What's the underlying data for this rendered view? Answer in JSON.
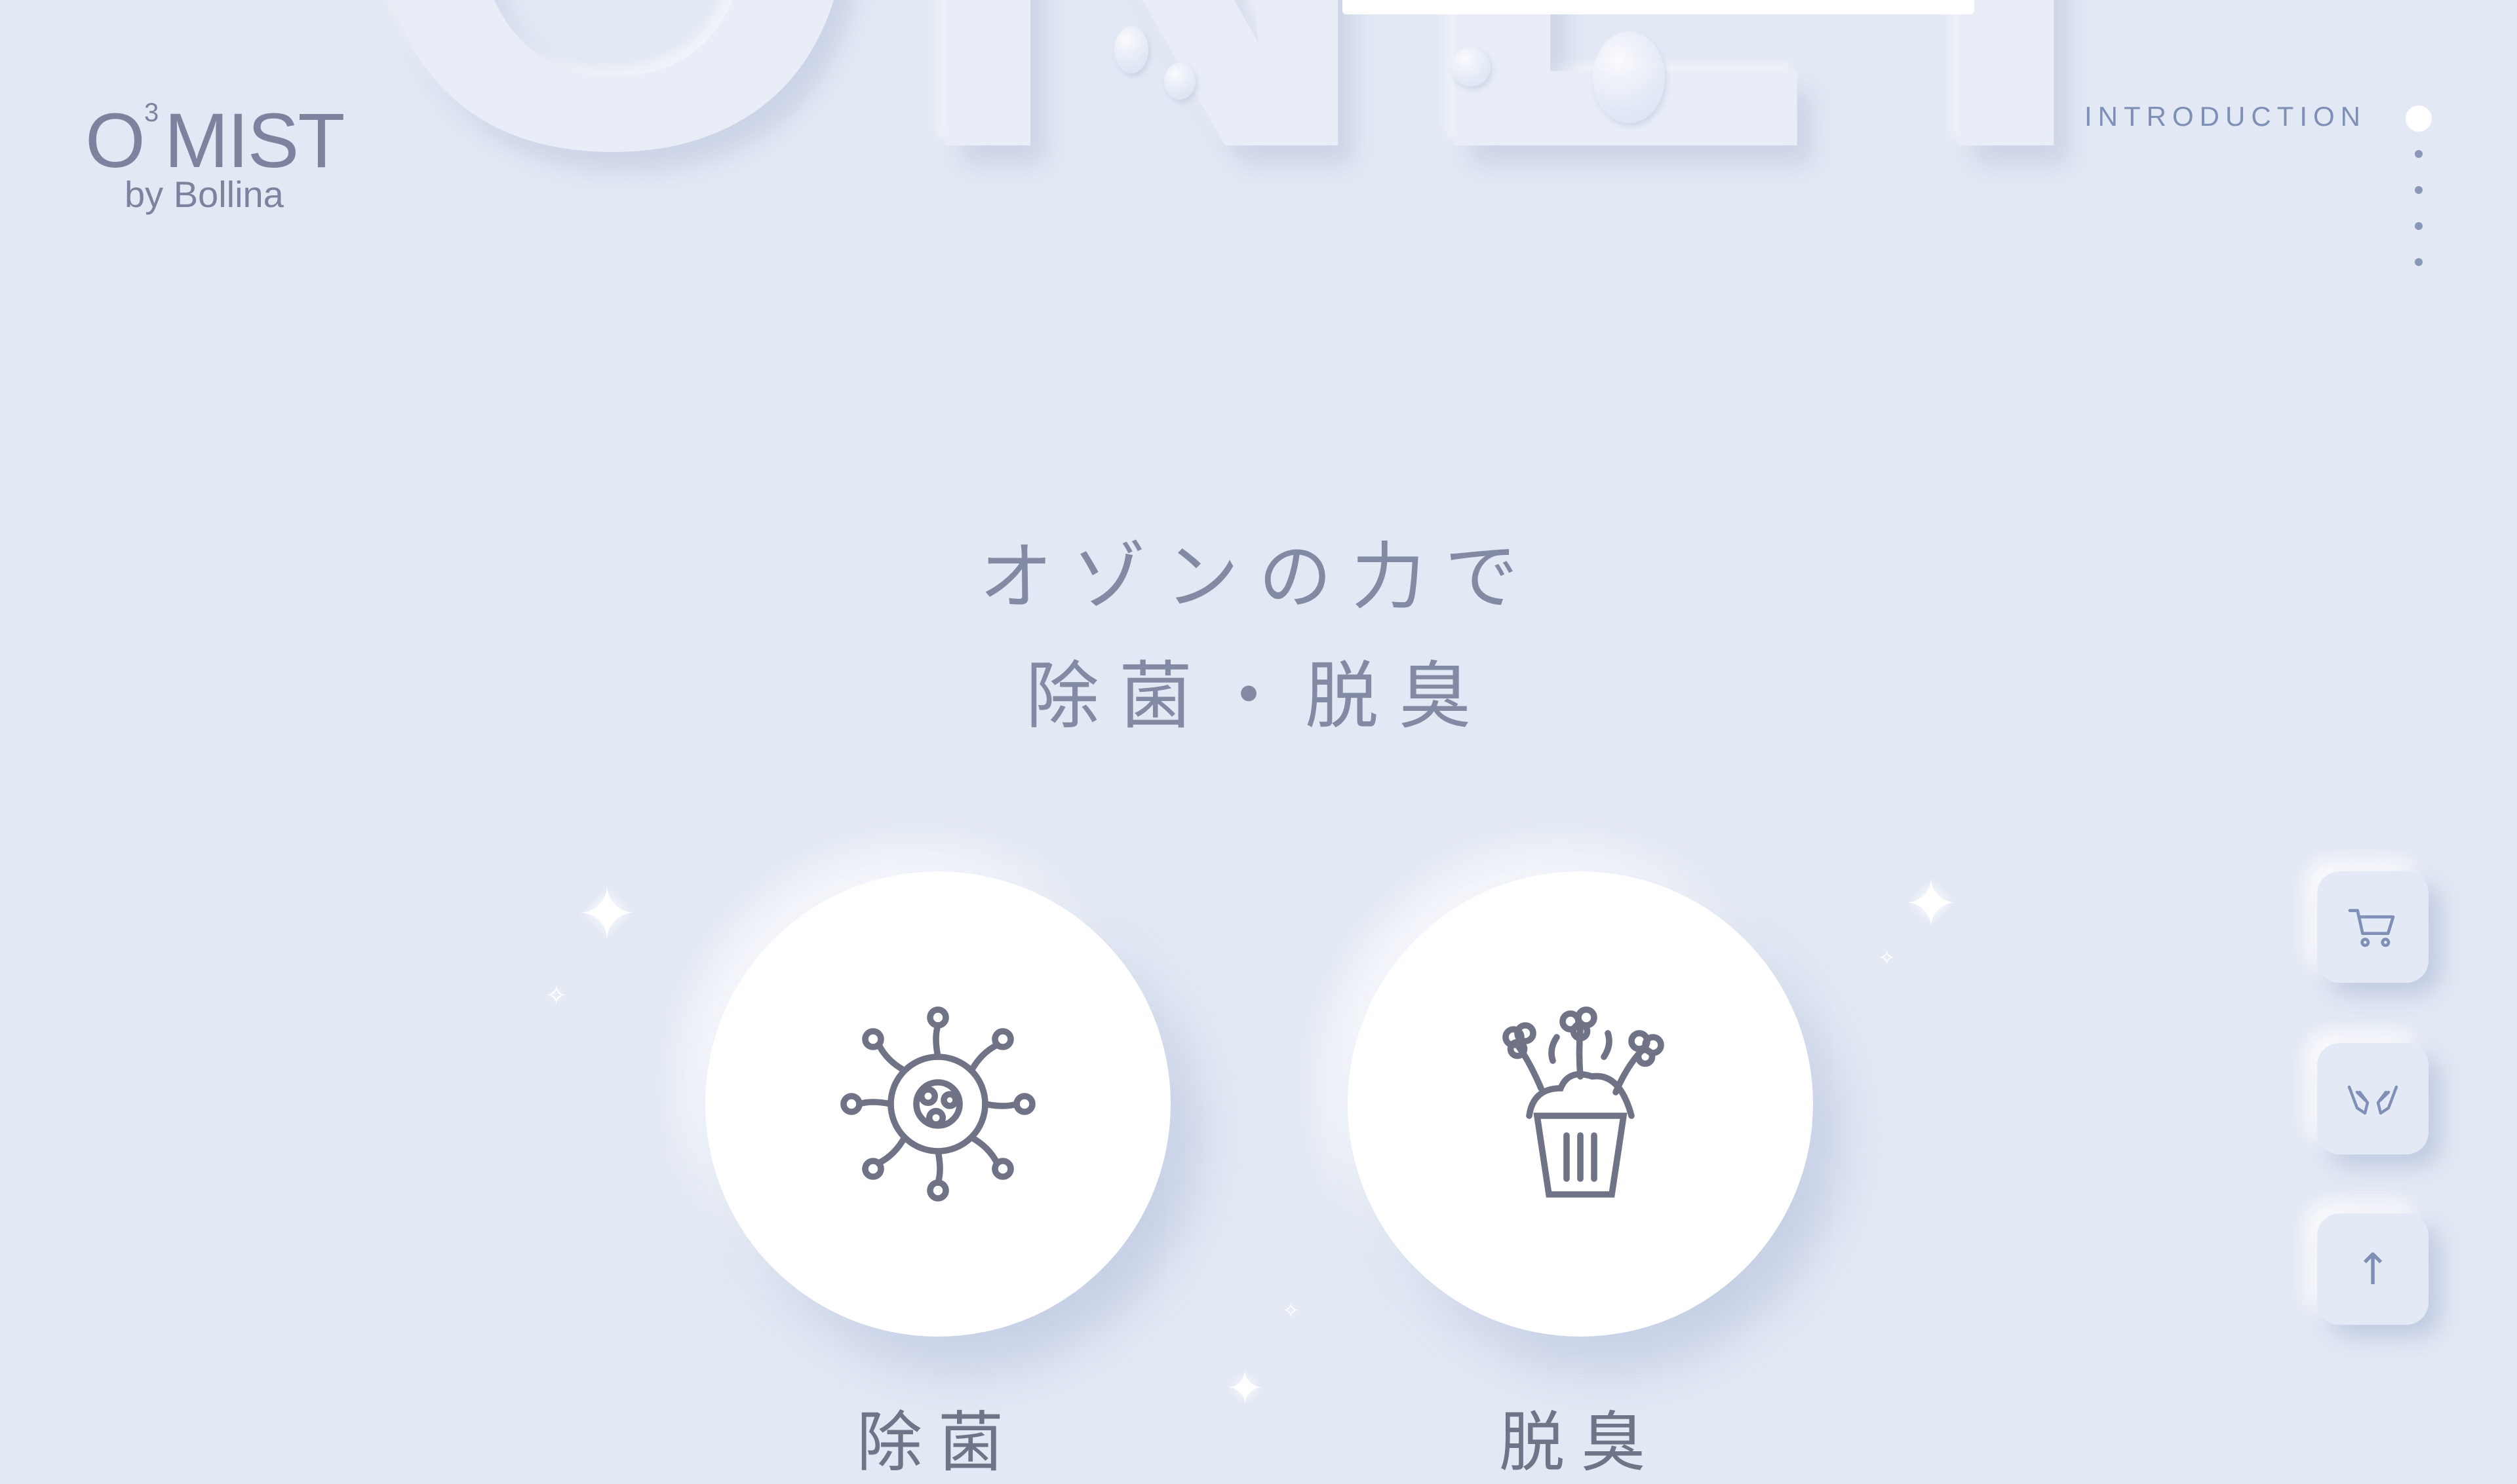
{
  "background": {
    "word": "ONLY"
  },
  "brand": {
    "logo_main": "O MIST",
    "logo_superscript": "3",
    "logo_sub": "by Bollina"
  },
  "section_nav": {
    "active_label": "INTRODUCTION",
    "items_count": 5
  },
  "heading": {
    "line1": "オゾンの力で",
    "line2": "除菌・脱臭"
  },
  "features": [
    {
      "icon": "virus-icon",
      "label": "除菌"
    },
    {
      "icon": "deodorize-trash-icon",
      "label": "脱臭"
    }
  ],
  "float_buttons": [
    {
      "icon": "cart-icon"
    },
    {
      "icon": "hands-icon"
    },
    {
      "icon": "arrow-up-icon",
      "glyph": "↑"
    }
  ],
  "colors": {
    "background": "#e3e9f4",
    "text": "#838aa3",
    "accent": "#7f8fb5",
    "card": "#ffffff"
  }
}
